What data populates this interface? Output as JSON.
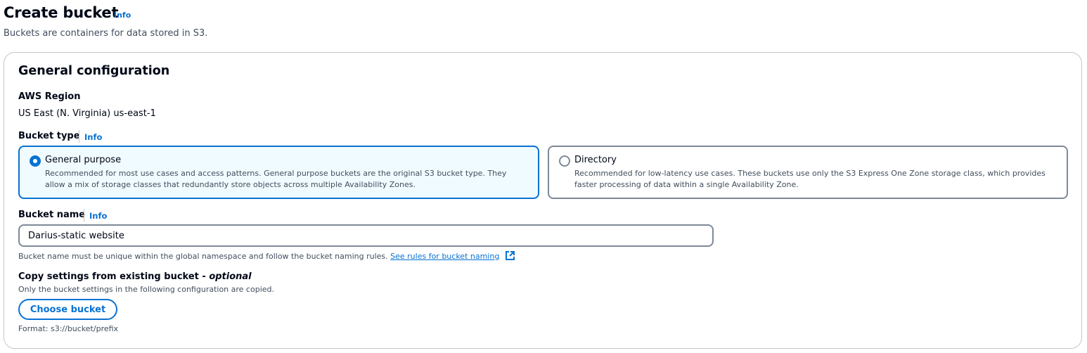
{
  "header": {
    "title": "Create bucket",
    "info": "Info",
    "description": "Buckets are containers for data stored in S3."
  },
  "general_config": {
    "title": "General configuration",
    "region_label": "AWS Region",
    "region_value": "US East (N. Virginia) us-east-1",
    "bucket_type_label": "Bucket type",
    "bucket_type_info": "Info",
    "bucket_types": [
      {
        "label": "General purpose",
        "description": "Recommended for most use cases and access patterns. General purpose buckets are the original S3 bucket type. They allow a mix of storage classes that redundantly store objects across multiple Availability Zones.",
        "selected": true
      },
      {
        "label": "Directory",
        "description": "Recommended for low-latency use cases. These buckets use only the S3 Express One Zone storage class, which provides faster processing of data within a single Availability Zone.",
        "selected": false
      }
    ],
    "bucket_name_label": "Bucket name",
    "bucket_name_info": "Info",
    "bucket_name_value": "Darius-static website",
    "bucket_name_hint": "Bucket name must be unique within the global namespace and follow the bucket naming rules.",
    "bucket_name_rules_link": "See rules for bucket naming",
    "copy_settings_label": "Copy settings from existing bucket - ",
    "copy_settings_optional": "optional",
    "copy_settings_desc": "Only the bucket settings in the following configuration are copied.",
    "choose_bucket_button": "Choose bucket",
    "format_hint": "Format: s3://bucket/prefix"
  },
  "colors": {
    "link": "#0972d3",
    "selected_bg": "#f0fbff",
    "border": "#7d8998",
    "text": "#000716",
    "muted": "#414d5c"
  },
  "icons": {
    "external_link": "external-link-icon"
  }
}
